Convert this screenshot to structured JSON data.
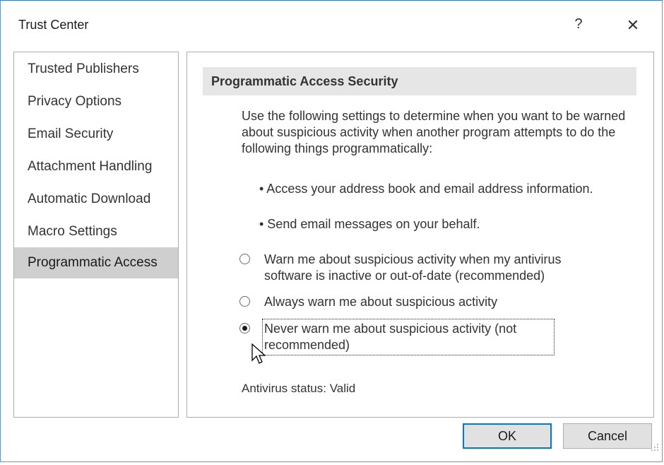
{
  "window": {
    "title": "Trust Center",
    "help_glyph": "?",
    "close_glyph": "✕"
  },
  "sidebar": {
    "items": [
      {
        "label": "Trusted Publishers"
      },
      {
        "label": "Privacy Options"
      },
      {
        "label": "Email Security"
      },
      {
        "label": "Attachment Handling"
      },
      {
        "label": "Automatic Download"
      },
      {
        "label": "Macro Settings"
      },
      {
        "label": "Programmatic Access"
      }
    ],
    "selected_index": 6
  },
  "content": {
    "header": "Programmatic Access Security",
    "description": "Use the following settings to determine when you want to be warned about suspicious activity when another program attempts to do the following things programmatically:",
    "bullets": [
      "•    Access your address book and email address information.",
      "•    Send email messages on your behalf."
    ],
    "options": [
      {
        "label": "Warn me about suspicious activity when my antivirus software is inactive or out-of-date (recommended)",
        "selected": false
      },
      {
        "label": "Always warn me about suspicious activity",
        "selected": false
      },
      {
        "label": "Never warn me about suspicious activity (not recommended)",
        "selected": true
      }
    ],
    "antivirus_status": "Antivirus status: Valid"
  },
  "footer": {
    "ok_label": "OK",
    "cancel_label": "Cancel"
  },
  "colors": {
    "window_border": "#2b7cd3",
    "selected_item": "#cfcfcf",
    "header_bg": "#e6e6e6",
    "default_button_border": "#0078d7"
  },
  "icons": {
    "cursor": "arrow-cursor-icon",
    "grip": "resize-grip-icon"
  }
}
